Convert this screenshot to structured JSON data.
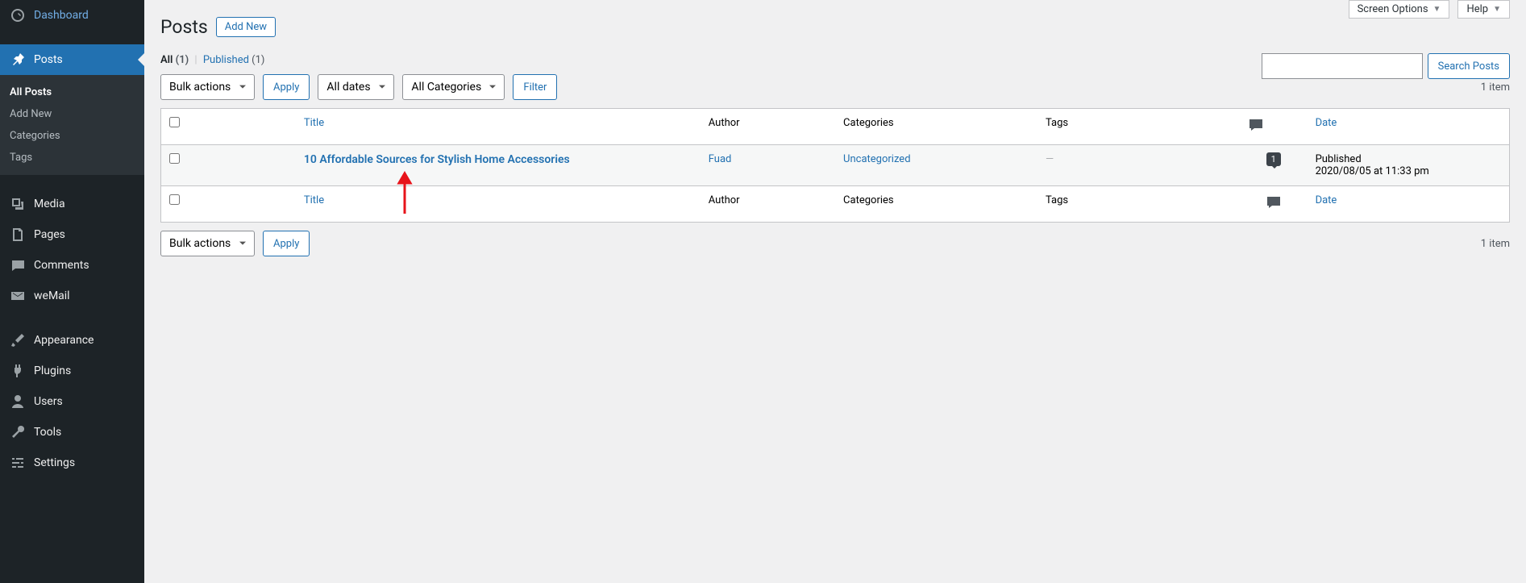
{
  "top_buttons": {
    "screen_options": "Screen Options",
    "help": "Help"
  },
  "sidebar": {
    "dashboard": "Dashboard",
    "posts": "Posts",
    "sub": {
      "all_posts": "All Posts",
      "add_new": "Add New",
      "categories": "Categories",
      "tags": "Tags"
    },
    "media": "Media",
    "pages": "Pages",
    "comments": "Comments",
    "wemail": "weMail",
    "appearance": "Appearance",
    "plugins": "Plugins",
    "users": "Users",
    "tools": "Tools",
    "settings": "Settings"
  },
  "page": {
    "heading": "Posts",
    "add_new": "Add New"
  },
  "views": {
    "all": "All",
    "all_count": "(1)",
    "published": "Published",
    "published_count": "(1)"
  },
  "filters": {
    "bulk": "Bulk actions",
    "apply": "Apply",
    "dates": "All dates",
    "cats": "All Categories",
    "filter": "Filter"
  },
  "search": {
    "button": "Search Posts"
  },
  "count_items": "1 item",
  "columns": {
    "title": "Title",
    "author": "Author",
    "categories": "Categories",
    "tags": "Tags",
    "date": "Date"
  },
  "row": {
    "title": "10 Affordable Sources for Stylish Home Accessories",
    "author": "Fuad",
    "category": "Uncategorized",
    "tags": "—",
    "comments": "1",
    "date_status": "Published",
    "date_value": "2020/08/05 at 11:33 pm"
  }
}
